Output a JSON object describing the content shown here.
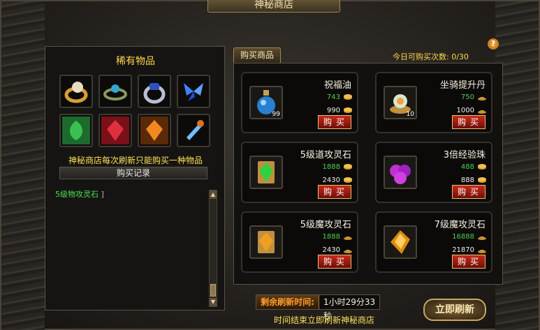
{
  "window": {
    "title": "神秘商店"
  },
  "rare": {
    "title": "稀有物品",
    "items": [
      {
        "icon": "gold-ring-icon"
      },
      {
        "icon": "jade-ring-icon"
      },
      {
        "icon": "silver-ring-icon"
      },
      {
        "icon": "blue-butterfly-icon"
      },
      {
        "icon": "green-leaf-icon"
      },
      {
        "icon": "red-crystal-icon"
      },
      {
        "icon": "orange-crystal-icon"
      },
      {
        "icon": "ice-spike-icon"
      }
    ],
    "notice": "神秘商店每次刷新只能购买一种物品",
    "record_button": "购买记录",
    "records": [
      {
        "name": "5级物攻灵石",
        "bracket": "]"
      }
    ]
  },
  "shop": {
    "tab": "购买商品",
    "count_label": "今日可购买次数: 0/30",
    "buy_label": "购买",
    "items": [
      {
        "name": "祝福油",
        "price_discount": "743",
        "price_original": "990",
        "stack": "99",
        "icon": "potion-bottle-icon"
      },
      {
        "name": "坐骑提升丹",
        "price_discount": "750",
        "price_original": "1000",
        "stack": "10",
        "icon": "mount-pill-icon"
      },
      {
        "name": "5级道攻灵石",
        "price_discount": "1888",
        "price_original": "2430",
        "stack": "",
        "icon": "green-gem-icon"
      },
      {
        "name": "3倍经验珠",
        "price_discount": "488",
        "price_original": "888",
        "stack": "",
        "icon": "exp-orb-icon"
      },
      {
        "name": "5级魔攻灵石",
        "price_discount": "1888",
        "price_original": "2430",
        "stack": "",
        "icon": "orange-gem-icon"
      },
      {
        "name": "7级魔攻灵石",
        "price_discount": "16888",
        "price_original": "21870",
        "stack": "",
        "icon": "amber-gem-icon"
      }
    ]
  },
  "refresh": {
    "label": "剩余刷新时间:",
    "time": "1小时29分33秒",
    "note": "时间结束立即刷新神秘商店",
    "button": "立即刷新"
  },
  "colors": {
    "accent": "#ffd84a",
    "green": "#4cd04c",
    "buy_red": "#c82a1a"
  }
}
